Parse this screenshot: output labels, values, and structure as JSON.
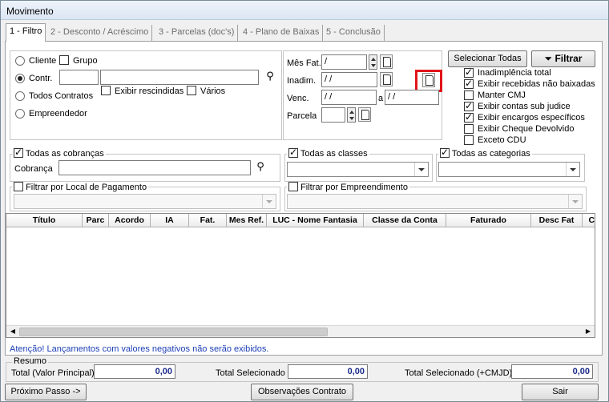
{
  "window": {
    "title": "Movimento"
  },
  "tabs": [
    {
      "label": "1 - Filtro"
    },
    {
      "label": "2 - Desconto / Acréscimo"
    },
    {
      "label": "3 - Parcelas (doc's)"
    },
    {
      "label": "4 - Plano de Baixas"
    },
    {
      "label": "5 - Conclusão"
    }
  ],
  "filter": {
    "radio_cliente": "Cliente",
    "chk_grupo": "Grupo",
    "radio_contr": "Contr.",
    "chk_exibir_rescindidas": "Exibir rescindidas",
    "chk_varios": "Vários",
    "radio_todos_contratos": "Todos Contratos",
    "radio_empreendedor": "Empreendedor",
    "contr_code": "",
    "contr_name": ""
  },
  "dates": {
    "mes_fat_label": "Mês Fat.",
    "mes_fat_value": "  /",
    "inadim_label": "Inadim.",
    "inadim_value": " /  /",
    "venc_label": "Venc.",
    "venc_from": " /  /",
    "venc_sep": "a",
    "venc_to": " /  /",
    "parcela_label": "Parcela",
    "parcela_value": ""
  },
  "buttons": {
    "selecionar_todas": "Selecionar Todas",
    "filtrar": "Filtrar",
    "proximo_passo": "Próximo Passo ->",
    "observacoes": "Observações Contrato",
    "sair": "Sair"
  },
  "options": [
    {
      "label": "Inadimplência total",
      "checked": true
    },
    {
      "label": "Exibir recebidas não baixadas",
      "checked": true
    },
    {
      "label": "Manter CMJ",
      "checked": false
    },
    {
      "label": "Exibir contas sub judice",
      "checked": true
    },
    {
      "label": "Exibir encargos específicos",
      "checked": true
    },
    {
      "label": "Exibir Cheque Devolvido",
      "checked": false
    },
    {
      "label": "Exceto CDU",
      "checked": false
    }
  ],
  "cobrancas": {
    "legend": "Todas as cobranças",
    "label": "Cobrança",
    "value": ""
  },
  "classes": {
    "legend": "Todas as classes"
  },
  "categorias": {
    "legend": "Todas as categorias"
  },
  "local_pagamento": {
    "legend": "Filtrar por Local de Pagamento"
  },
  "empreendimento": {
    "legend": "Filtrar por Empreendimento"
  },
  "grid": {
    "columns": [
      "Título",
      "Parc",
      "Acordo",
      "IA",
      "Fat.",
      "Mes Ref.",
      "LUC - Nome Fantasia",
      "Classe da Conta",
      "Faturado",
      "Desc Fat",
      "Co"
    ]
  },
  "warning": "Atenção! Lançamentos com valores negativos não serão exibidos.",
  "resumo": {
    "legend": "Resumo",
    "total_principal_label": "Total (Valor Principal)",
    "total_principal_value": "0,00",
    "total_selecionado_label": "Total Selecionado",
    "total_selecionado_value": "0,00",
    "total_cmjd_label": "Total Selecionado (+CMJD)",
    "total_cmjd_value": "0,00"
  }
}
